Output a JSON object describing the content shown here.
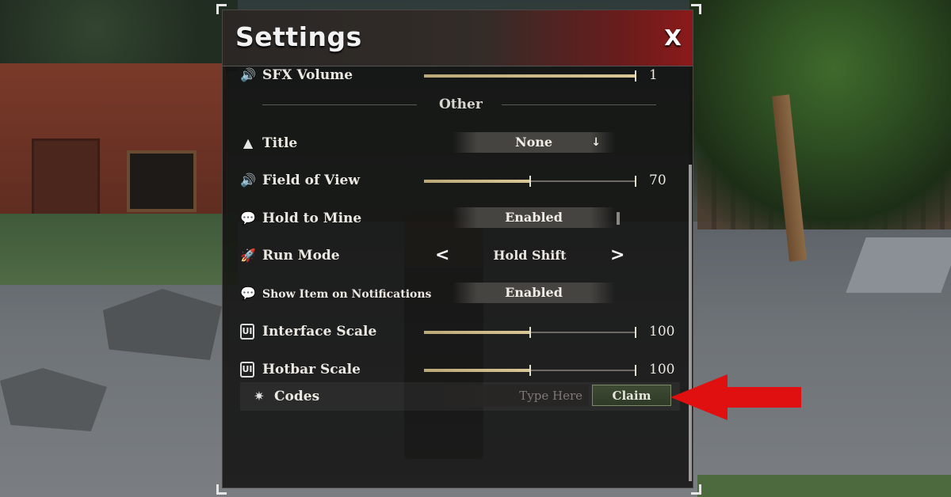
{
  "window": {
    "title": "Settings",
    "close_label": "X"
  },
  "rows": {
    "sfx": {
      "label": "SFX Volume",
      "value": "1",
      "fill": 1.0
    },
    "section_other": "Other",
    "title": {
      "label": "Title",
      "value": "None",
      "arrow": "↓"
    },
    "fov": {
      "label": "Field of View",
      "value": "70",
      "fill": 0.5
    },
    "hold_to_mine": {
      "label": "Hold to Mine",
      "value": "Enabled"
    },
    "run_mode": {
      "label": "Run Mode",
      "value": "Hold Shift",
      "prev": "<",
      "next": ">"
    },
    "show_item": {
      "label": "Show Item on Notifications",
      "value": "Enabled"
    },
    "interface_scale": {
      "label": "Interface Scale",
      "value": "100",
      "fill": 0.5,
      "icon_text": "UI"
    },
    "hotbar_scale": {
      "label": "Hotbar Scale",
      "value": "100",
      "fill": 0.5,
      "icon_text": "UI"
    },
    "codes": {
      "label": "Codes",
      "placeholder": "Type Here",
      "button": "Claim"
    }
  },
  "icons": {
    "sfx": "speaker-icon",
    "title": "witch-hat-icon",
    "fov": "speaker-icon",
    "hold_to_mine": "chat-bubble-icon",
    "run_mode": "rocket-icon",
    "show_item": "chat-bubble-icon",
    "interface_scale": "ui-icon",
    "hotbar_scale": "ui-icon",
    "codes": "sparkle-icon"
  },
  "colors": {
    "accent_red": "#8b1a1a",
    "slider_fill": "#d9c896",
    "claim_green": "#3e4b34",
    "arrow_red": "#e01010"
  }
}
